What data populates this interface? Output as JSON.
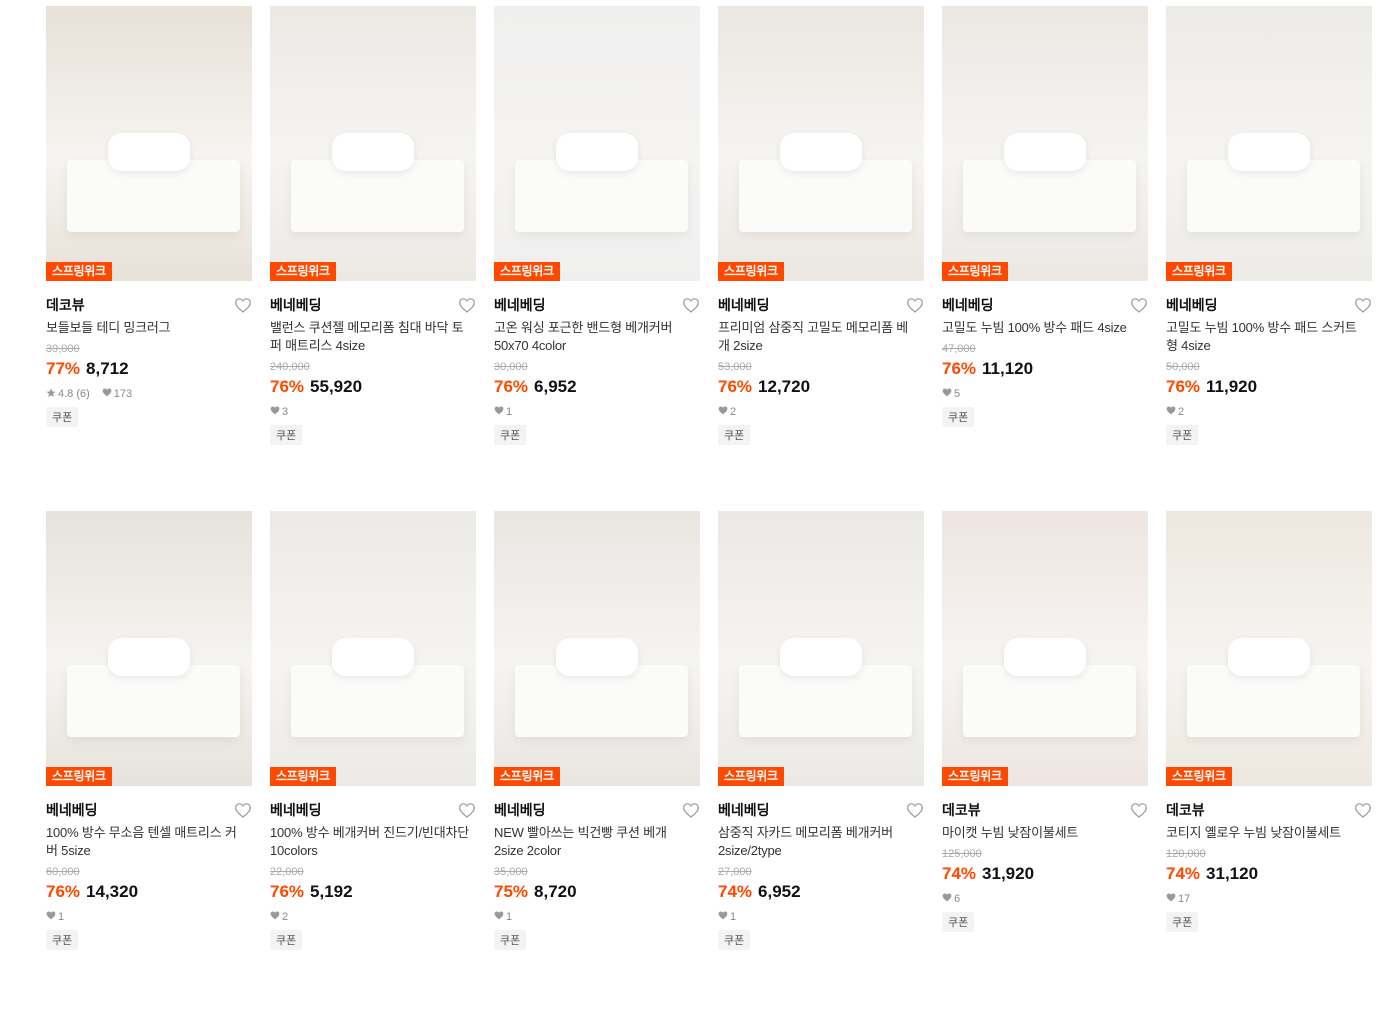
{
  "badge_label": "스프링위크",
  "coupon_label": "쿠폰",
  "products": [
    {
      "brand": "데코뷰",
      "title": "보들보들 테디 밍크러그",
      "orig": "39,000",
      "disc": "77%",
      "price": "8,712",
      "rating": "4.8 (6)",
      "likes": "173",
      "bg": "#e7e1d8"
    },
    {
      "brand": "베네베딩",
      "title": "밸런스 쿠션젤 메모리폼 침대 바닥 토퍼 매트리스 4size",
      "orig": "240,000",
      "disc": "76%",
      "price": "55,920",
      "rating": "",
      "likes": "3",
      "bg": "#ece9e5"
    },
    {
      "brand": "베네베딩",
      "title": "고온 워싱 포근한 밴드형 베개커버 50x70 4color",
      "orig": "30,000",
      "disc": "76%",
      "price": "6,952",
      "rating": "",
      "likes": "1",
      "bg": "#efefef"
    },
    {
      "brand": "베네베딩",
      "title": "프리미엄 삼중직 고밀도 메모리폼 베개 2size",
      "orig": "53,000",
      "disc": "76%",
      "price": "12,720",
      "rating": "",
      "likes": "2",
      "bg": "#ebe7e2"
    },
    {
      "brand": "베네베딩",
      "title": "고밀도 누빔 100% 방수 패드 4size",
      "orig": "47,000",
      "disc": "76%",
      "price": "11,120",
      "rating": "",
      "likes": "5",
      "bg": "#ebe8e4"
    },
    {
      "brand": "베네베딩",
      "title": "고밀도 누빔 100% 방수 패드 스커트형 4size",
      "orig": "50,000",
      "disc": "76%",
      "price": "11,920",
      "rating": "",
      "likes": "2",
      "bg": "#ecebe8"
    },
    {
      "brand": "베네베딩",
      "title": "100% 방수 무소음 텐셀 매트리스 커버 5size",
      "orig": "60,000",
      "disc": "76%",
      "price": "14,320",
      "rating": "",
      "likes": "1",
      "bg": "#e6e2dc"
    },
    {
      "brand": "베네베딩",
      "title": "100% 방수 베개커버 진드기/빈대차단 10colors",
      "orig": "22,000",
      "disc": "76%",
      "price": "5,192",
      "rating": "",
      "likes": "2",
      "bg": "#eceae7"
    },
    {
      "brand": "베네베딩",
      "title": "NEW 빨아쓰는 빅건빵 쿠션 베개 2size 2color",
      "orig": "35,000",
      "disc": "75%",
      "price": "8,720",
      "rating": "",
      "likes": "1",
      "bg": "#e9e6e2"
    },
    {
      "brand": "베네베딩",
      "title": "삼중직 자카드 메모리폼 베개커버 2size/2type",
      "orig": "27,000",
      "disc": "74%",
      "price": "6,952",
      "rating": "",
      "likes": "1",
      "bg": "#ebe9e6"
    },
    {
      "brand": "데코뷰",
      "title": "마이캣 누빔 낮잠이불세트",
      "orig": "125,000",
      "disc": "74%",
      "price": "31,920",
      "rating": "",
      "likes": "6",
      "bg": "#eee5e2"
    },
    {
      "brand": "데코뷰",
      "title": "코티지 옐로우 누빔 낮잠이불세트",
      "orig": "120,000",
      "disc": "74%",
      "price": "31,120",
      "rating": "",
      "likes": "17",
      "bg": "#ede8df"
    }
  ]
}
